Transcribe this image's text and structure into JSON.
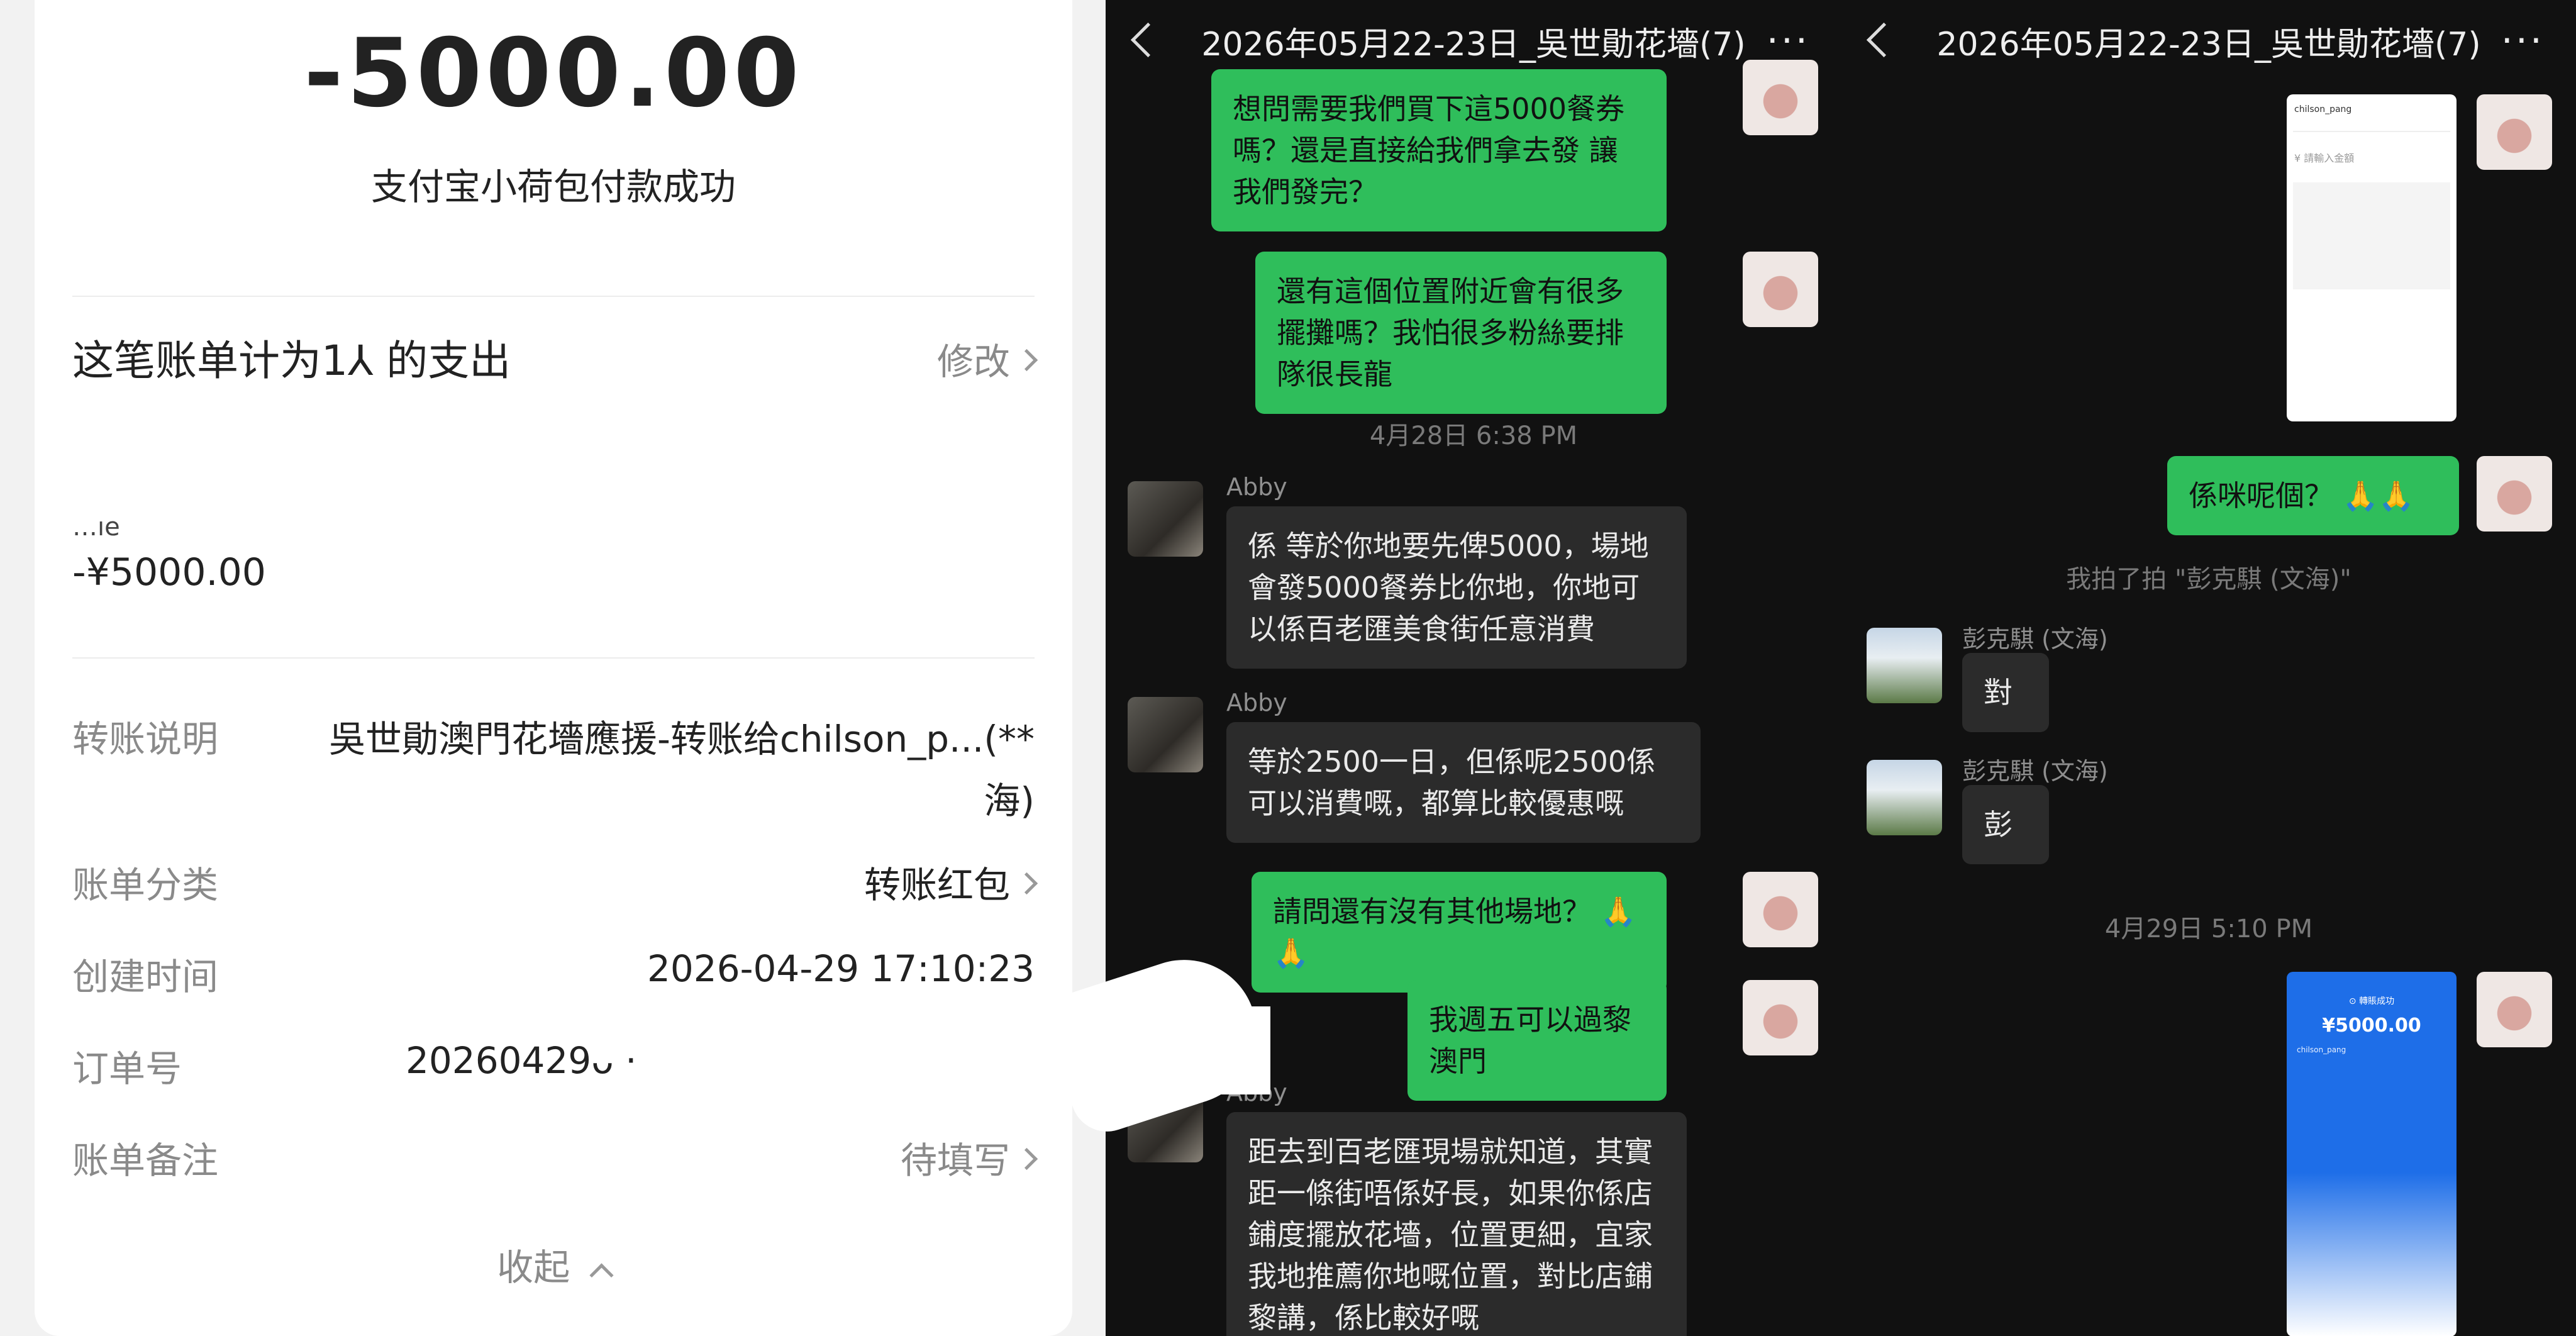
{
  "payment": {
    "amount": "-5000.00",
    "subtitle": "支付宝小荷包付款成功",
    "bill_statement": "这笔账单计为1⅄ 的支出",
    "modify_label": "修改",
    "partial_label": "…ıe",
    "sub_amount": "-¥5000.00",
    "transfer_desc_label": "转账说明",
    "transfer_desc_value_1": "吳世勛澳門花墻應援-转账给chilson_p...(**",
    "transfer_desc_value_2": "海)",
    "category_label": "账单分类",
    "category_value": "转账红包",
    "created_label": "创建时间",
    "created_value": "2026-04-29 17:10:23",
    "order_label": "订单号",
    "order_value": "20260429ᴗ ·",
    "remark_label": "账单备注",
    "remark_value": "待填写",
    "collapse_label": "收起"
  },
  "chat_mid": {
    "title": "2026年05月22-23日_吳世勛花墻(7)",
    "more": "···",
    "msg1": "想問需要我們買下這5000餐券嗎？還是直接給我們拿去發 讓我們發完？",
    "msg2": "還有這個位置附近會有很多擺攤嗎？我怕很多粉絲要排隊很長龍",
    "ts1": "4月28日 6:38 PM",
    "sender_abby": "Abby",
    "msg3": "係 等於你地要先俾5000，場地會發5000餐券比你地，你地可以係百老匯美食街任意消費",
    "msg4": "等於2500一日，但係呢2500係可以消費嘅，都算比較優惠嘅",
    "msg5": "請問還有沒有其他場地？ 🙏🙏",
    "msg6": "我週五可以過黎澳門",
    "msg7": "距去到百老匯現場就知道，其實距一條街唔係好長，如果你係店鋪度擺放花墻，位置更細，宜家我地推薦你地嘅位置，對比店鋪黎講，係比較好嘅"
  },
  "chat_right": {
    "title": "2026年05月22-23日_吳世勛花墻(7)",
    "more": "···",
    "msg1": "係咪呢個？ 🙏🙏",
    "sys1": "我拍了拍 \"彭克騏 (文海)\"",
    "sender_peng": "彭克騏 (文海)",
    "msg2": "對",
    "msg3": "彭",
    "ts1": "4月29日 5:10 PM",
    "shot_amount": "¥5000.00",
    "shot_status": "⊙ 轉賬成功",
    "shot_name": "chilson_pang",
    "shot_input": "¥ 請輸入金額"
  },
  "colors": {
    "green_bubble": "#2fbe5b",
    "dark_bubble": "#2b2b2b",
    "chat_bg": "#111111"
  }
}
